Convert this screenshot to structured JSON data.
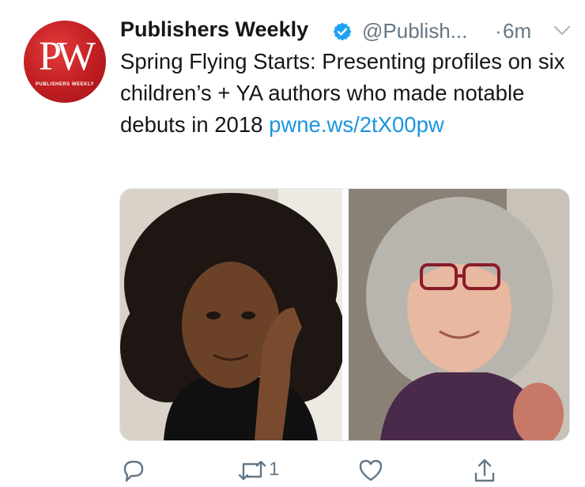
{
  "tweet": {
    "author": {
      "display_name": "Publishers Weekly",
      "handle": "@Publish...",
      "avatar_logo_text": "PW",
      "avatar_logo_subtext": "PUBLISHERS WEEKLY"
    },
    "separator": "·",
    "timestamp": "6m",
    "text": "Spring Flying Starts: Presenting profiles on six children’s + YA authors who made notable debuts in 2018 ",
    "link": "pwne.ws/​2tX00pw",
    "actions": {
      "retweet_count": "1"
    }
  },
  "colors": {
    "accent_link": "#1b95e0",
    "verified_badge": "#1da1f2",
    "muted_text": "#657786",
    "avatar_red": "#c01e22"
  },
  "icons": [
    "verified-badge-icon",
    "chevron-down-icon",
    "reply-icon",
    "retweet-icon",
    "like-icon",
    "share-icon"
  ]
}
